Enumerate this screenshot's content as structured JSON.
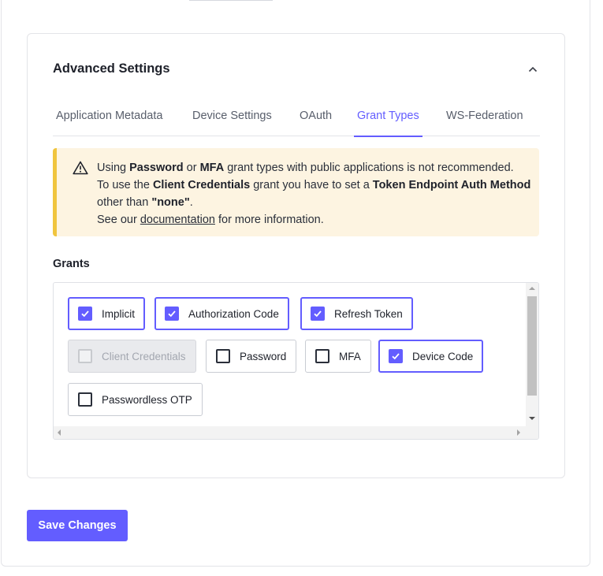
{
  "advanced": {
    "title": "Advanced Settings",
    "tabs": [
      {
        "label": "Application Metadata",
        "active": false
      },
      {
        "label": "Device Settings",
        "active": false
      },
      {
        "label": "OAuth",
        "active": false
      },
      {
        "label": "Grant Types",
        "active": true
      },
      {
        "label": "WS-Federation",
        "active": false
      }
    ]
  },
  "alert": {
    "icon": "warning-triangle-icon",
    "line1": {
      "t1": "Using ",
      "b1": "Password",
      "t2": " or ",
      "b2": "MFA",
      "t3": " grant types with public applications is not recommended."
    },
    "line2": {
      "t1": "To use the ",
      "b1": "Client Credentials",
      "t2": " grant you have to set a ",
      "b2": "Token Endpoint Auth Method",
      "t3": " other than ",
      "b3": "\"none\"",
      "t4": "."
    },
    "line3": {
      "t1": "See our ",
      "link": "documentation",
      "t2": " for more information."
    }
  },
  "grants": {
    "label": "Grants",
    "items": [
      {
        "label": "Implicit",
        "checked": true,
        "disabled": false
      },
      {
        "label": "Authorization Code",
        "checked": true,
        "disabled": false
      },
      {
        "label": "Refresh Token",
        "checked": true,
        "disabled": false
      },
      {
        "label": "Client Credentials",
        "checked": false,
        "disabled": true
      },
      {
        "label": "Password",
        "checked": false,
        "disabled": false
      },
      {
        "label": "MFA",
        "checked": false,
        "disabled": false
      },
      {
        "label": "Device Code",
        "checked": true,
        "disabled": false
      },
      {
        "label": "Passwordless OTP",
        "checked": false,
        "disabled": false
      }
    ]
  },
  "actions": {
    "save_label": "Save Changes"
  },
  "colors": {
    "accent": "#635dff",
    "warning_bar": "#f0c53e",
    "warning_bg": "#fdf4e1"
  }
}
